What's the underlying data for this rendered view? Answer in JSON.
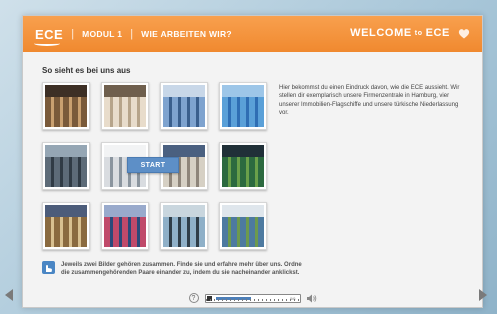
{
  "header": {
    "logo": "ECE",
    "module": "MODUL 1",
    "section": "WIE ARBEITEN WIR?",
    "welcome_pre": "WELCOME",
    "welcome_to": "to",
    "welcome_post": "ECE"
  },
  "main": {
    "title": "So sieht es bei uns aus",
    "start_label": "START",
    "intro": "Hier bekommst du einen Eindruck davon, wie die ECE aussieht. Wir stellen dir exemplarisch unsere Firmenzentrale in Hamburg, vier unserer Immobilien-Flagschiffe und unsere türkische Niederlassung vor.",
    "instruction": "Jeweils zwei Bilder gehören zusammen. Finde sie und erfahre mehr über uns. Ordne die zusammengehörenden Paare einander zu, indem du sie nacheinander anklickst."
  },
  "tiles": [
    {
      "id": "t1",
      "colors": [
        "#7a5a3a",
        "#c9a070",
        "#3d2f25"
      ]
    },
    {
      "id": "t2",
      "colors": [
        "#e8dccb",
        "#b6a48a",
        "#6f5f4d"
      ]
    },
    {
      "id": "t3",
      "colors": [
        "#7ea3cf",
        "#3a5f8d",
        "#c8d7e8"
      ]
    },
    {
      "id": "t4",
      "colors": [
        "#5aa0d8",
        "#2f6eb4",
        "#9dc6e8"
      ]
    },
    {
      "id": "t5",
      "colors": [
        "#5d6b78",
        "#303b45",
        "#95a6b4"
      ]
    },
    {
      "id": "t6",
      "colors": [
        "#d9dce0",
        "#8a949e",
        "#f2f3f4"
      ]
    },
    {
      "id": "t7",
      "colors": [
        "#d6d0c4",
        "#8e857a",
        "#4a6080"
      ]
    },
    {
      "id": "t8",
      "colors": [
        "#2c6a3f",
        "#6aa04a",
        "#203038"
      ]
    },
    {
      "id": "t9",
      "colors": [
        "#8a6a3f",
        "#d8c090",
        "#4c5c7a"
      ]
    },
    {
      "id": "t10",
      "colors": [
        "#c04a6a",
        "#2a4a7a",
        "#9ac"
      ]
    },
    {
      "id": "t11",
      "colors": [
        "#8fb0c8",
        "#2f3d48",
        "#c9d6de"
      ]
    },
    {
      "id": "t12",
      "colors": [
        "#4d7aa0",
        "#6d9a4d",
        "#dfe6ec"
      ]
    }
  ],
  "footer": {
    "help_label": "?",
    "progress_label": "0/6",
    "progress_value": 0.5
  },
  "colors": {
    "accent": "#f0892f",
    "button": "#5d8fc7"
  }
}
